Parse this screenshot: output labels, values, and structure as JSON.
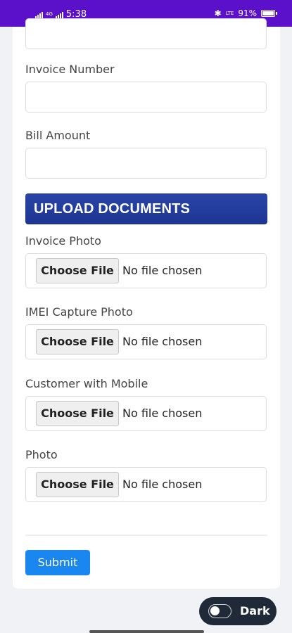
{
  "status_bar": {
    "network_left": "4G",
    "time": "5:38",
    "network_right": "LTE",
    "battery": "91%"
  },
  "form": {
    "invoice_number_label": "Invoice Number",
    "bill_amount_label": "Bill Amount",
    "section_title": "UPLOAD DOCUMENTS",
    "uploads": [
      {
        "label": "Invoice Photo",
        "button": "Choose File",
        "status": "No file chosen"
      },
      {
        "label": "IMEI Capture Photo",
        "button": "Choose File",
        "status": "No file chosen"
      },
      {
        "label": "Customer with Mobile",
        "button": "Choose File",
        "status": "No file chosen"
      },
      {
        "label": "Photo",
        "button": "Choose File",
        "status": "No file chosen"
      }
    ],
    "submit_label": "Submit"
  },
  "theme_toggle": {
    "label": "Dark",
    "enabled": false
  },
  "colors": {
    "status_bar": "#5a11c9",
    "section_header": "#1d3591",
    "submit": "#1a86f0",
    "toggle_bg": "#1f2937"
  }
}
